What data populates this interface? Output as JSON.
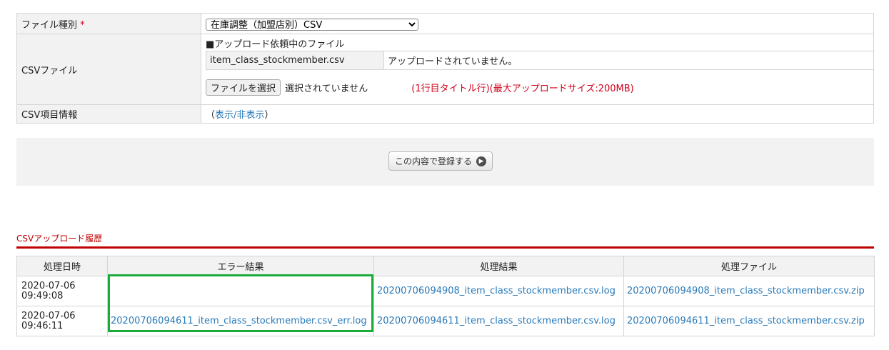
{
  "form": {
    "file_type_label": "ファイル種別",
    "required_mark": "*",
    "file_type_selected": "在庫調整（加盟店別）CSV",
    "csv_file_label": "CSVファイル",
    "pending_heading": "■アップロード依頼中のファイル",
    "pending_file_name": "item_class_stockmember.csv",
    "pending_file_status": "アップロードされていません。",
    "choose_file_button": "ファイルを選択",
    "no_file_selected": "選択されていません",
    "upload_note": "(1行目タイトル行)(最大アップロードサイズ:200MB)",
    "csv_item_info_label": "CSV項目情報",
    "toggle_open": "（",
    "toggle_link": "表示/非表示",
    "toggle_close": "）"
  },
  "submit": {
    "label": "この内容で登録する",
    "icon": "arrow-right-circle-icon"
  },
  "history": {
    "title": "CSVアップロード履歴",
    "columns": [
      "処理日時",
      "エラー結果",
      "処理結果",
      "処理ファイル"
    ],
    "rows": [
      {
        "date": "2020-07-06",
        "time": "09:49:08",
        "error_result": "",
        "result": "20200706094908_item_class_stockmember.csv.log",
        "file": "20200706094908_item_class_stockmember.csv.zip"
      },
      {
        "date": "2020-07-06",
        "time": "09:46:11",
        "error_result": "20200706094611_item_class_stockmember.csv_err.log",
        "result": "20200706094611_item_class_stockmember.csv.log",
        "file": "20200706094611_item_class_stockmember.csv.zip"
      }
    ]
  },
  "colors": {
    "accent_red": "#c00000",
    "link_blue": "#2a7ab8",
    "highlight_green": "#1aab3a"
  }
}
